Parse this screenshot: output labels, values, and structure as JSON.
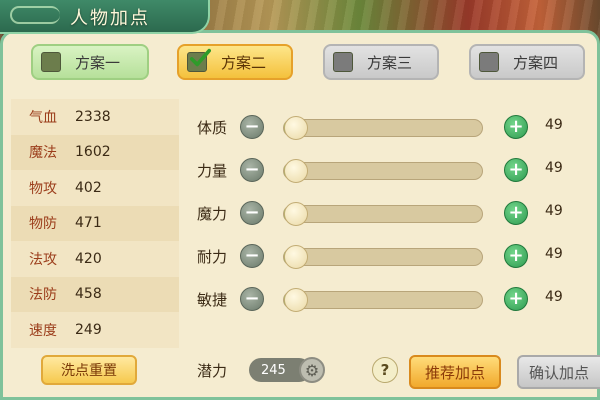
{
  "window": {
    "title": "人物加点"
  },
  "tabs": [
    {
      "label": "方案一",
      "selected": false
    },
    {
      "label": "方案二",
      "selected": true
    },
    {
      "label": "方案三",
      "selected": false
    },
    {
      "label": "方案四",
      "selected": false
    }
  ],
  "stats": [
    {
      "label": "气血",
      "value": "2338"
    },
    {
      "label": "魔法",
      "value": "1602"
    },
    {
      "label": "物攻",
      "value": "402"
    },
    {
      "label": "物防",
      "value": "471"
    },
    {
      "label": "法攻",
      "value": "420"
    },
    {
      "label": "法防",
      "value": "458"
    },
    {
      "label": "速度",
      "value": "249"
    }
  ],
  "reset_label": "洗点重置",
  "attributes": [
    {
      "name": "体质",
      "value": "49",
      "level": 0
    },
    {
      "name": "力量",
      "value": "49",
      "level": 0
    },
    {
      "name": "魔力",
      "value": "49",
      "level": 0
    },
    {
      "name": "耐力",
      "value": "49",
      "level": 0
    },
    {
      "name": "敏捷",
      "value": "49",
      "level": 0
    }
  ],
  "icons": {
    "minus": "minus-icon",
    "plus": "plus-icon",
    "gear": "gear-icon",
    "help": "help-icon",
    "check": "check-icon"
  },
  "bottom": {
    "potential_label": "潜力",
    "potential_value": "245",
    "help_symbol": "?",
    "recommend_label": "推荐加点",
    "confirm_label": "确认加点"
  },
  "colors": {
    "panel_bg": "#f5ecd0",
    "frame": "#7fc29a",
    "slider_fill": "#4aa72a",
    "stat_label": "#9b3d1b"
  }
}
